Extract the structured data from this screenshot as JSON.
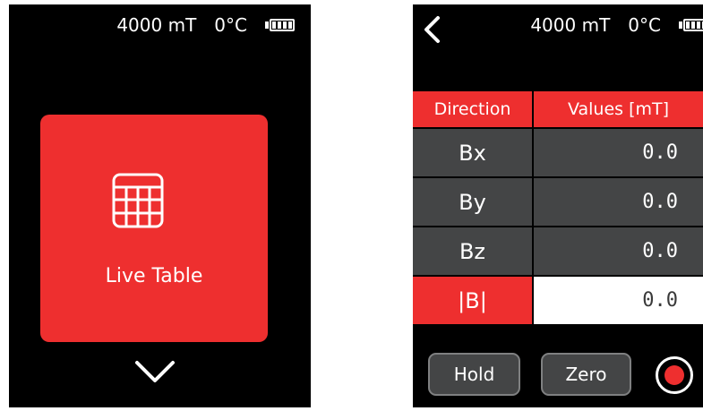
{
  "left_screen": {
    "status": {
      "field": "4000 mT",
      "temperature": "0°C"
    },
    "tile": {
      "label": "Live Table"
    }
  },
  "right_screen": {
    "status": {
      "field": "4000 mT",
      "temperature": "0°C"
    },
    "table": {
      "headers": [
        "Direction",
        "Values [mT]"
      ],
      "rows": [
        {
          "direction": "Bx",
          "value": "0.0"
        },
        {
          "direction": "By",
          "value": "0.0"
        },
        {
          "direction": "Bz",
          "value": "0.0"
        },
        {
          "direction": "|B|",
          "value": "0.0"
        }
      ]
    },
    "buttons": {
      "hold": "Hold",
      "zero": "Zero"
    }
  },
  "colors": {
    "accent": "#ee2f2f",
    "cell": "#444546",
    "screen": "#000000"
  },
  "icons": [
    "battery-icon",
    "table-icon",
    "chevron-down-icon",
    "back-arrow-icon",
    "record-icon"
  ]
}
